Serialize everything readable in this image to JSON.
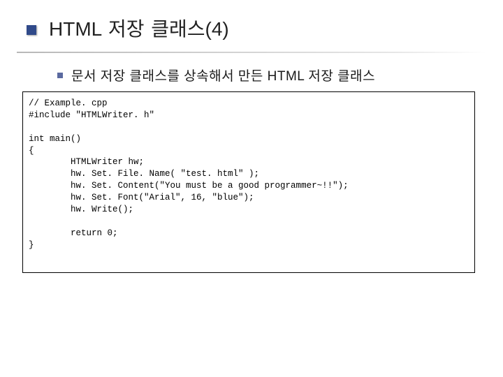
{
  "header": {
    "title": "HTML 저장 클래스(4)"
  },
  "body": {
    "bullet": "문서 저장 클래스를 상속해서 만든 HTML 저장 클래스",
    "code": "// Example. cpp\n#include \"HTMLWriter. h\"\n\nint main()\n{\n        HTMLWriter hw;\n        hw. Set. File. Name( \"test. html\" );\n        hw. Set. Content(\"You must be a good programmer~!!\");\n        hw. Set. Font(\"Arial\", 16, \"blue\");\n        hw. Write();\n\n        return 0;\n}"
  }
}
